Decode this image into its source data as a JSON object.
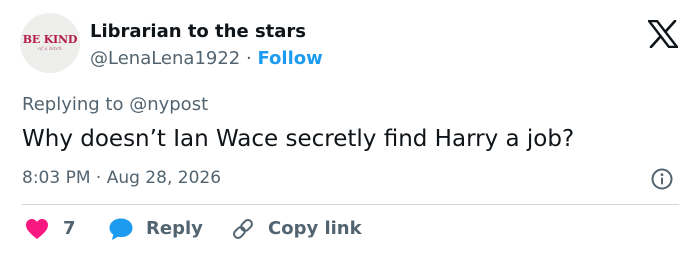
{
  "author": {
    "display_name": "Librarian to the stars",
    "handle": "@LenaLena1922",
    "separator": "·",
    "follow_label": "Follow",
    "avatar_text": "BE KIND",
    "avatar_subtext": "of a bitch"
  },
  "reply_context": {
    "text": "Replying to @nypost"
  },
  "tweet": {
    "text": "Why doesn’t Ian Wace secretly find Harry a job?",
    "timestamp": "8:03 PM · Aug 28, 2026"
  },
  "actions": {
    "like_count": "7",
    "reply_label": "Reply",
    "copy_label": "Copy link"
  },
  "colors": {
    "accent": "#1d9bf0",
    "like": "#f91880",
    "text": "#0f1419",
    "muted": "#536471",
    "divider": "#cfd9de",
    "avatar_text": "#b01c4b"
  },
  "icons": {
    "logo": "x-logo-icon",
    "info": "info-icon",
    "like": "heart-icon",
    "reply": "speech-bubble-icon",
    "copy": "link-icon"
  }
}
